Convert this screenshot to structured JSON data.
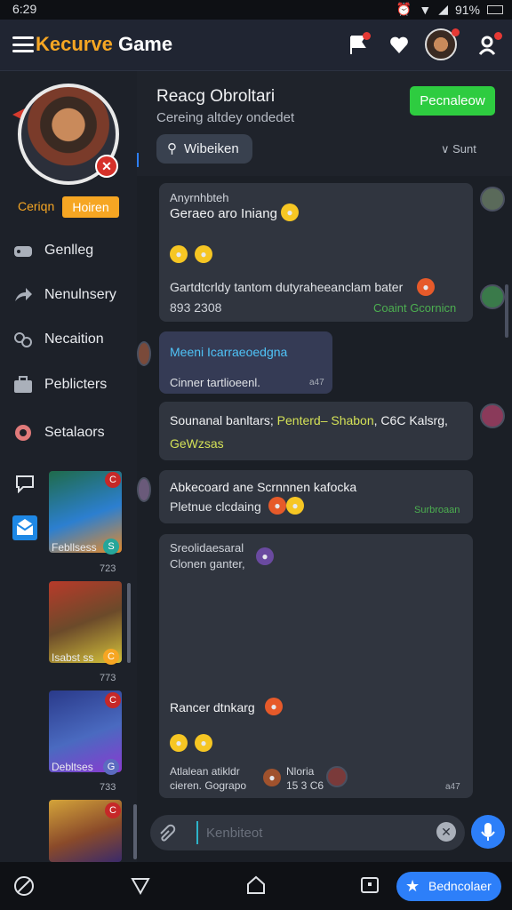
{
  "status_bar": {
    "time": "6:29",
    "battery": "91%"
  },
  "app": {
    "brand_part1": "Kecurve",
    "brand_part2": " Game"
  },
  "profile": {
    "rank_label": "Ceriqn",
    "rank_pill": "Hoiren"
  },
  "sidebar": {
    "items": [
      {
        "label": "Genlleg",
        "icon": "controller-icon"
      },
      {
        "label": "Nenulnsery",
        "icon": "share-arrow-icon"
      },
      {
        "label": "Necaition",
        "icon": "link-icon"
      },
      {
        "label": "Peblicters",
        "icon": "briefcase-icon"
      },
      {
        "label": "Setalaors",
        "icon": "gear-icon"
      }
    ],
    "thumbnails": [
      {
        "caption": "Febllsess",
        "count": "723"
      },
      {
        "caption": "Isabst ss",
        "count": "773"
      },
      {
        "caption": "Debltses",
        "count": "733"
      },
      {
        "caption": "",
        "count": ""
      }
    ]
  },
  "chat_header": {
    "title": "Reacg Obroltari",
    "subtitle": "Cereing altdey ondedet",
    "action_button": "Pecnaleow",
    "search_chip": "Wibeiken",
    "sort_label": "∨ Sunt"
  },
  "messages": [
    {
      "sender": "Anyrnhbteh",
      "line1": "Geraeo aro Iniang",
      "line2": "Gartdtcrldy tantom dutyraheeanclam bater",
      "meta_left": "893 2308",
      "meta_right": "Coaint Gcornicn"
    },
    {
      "line1": "Meeni Icarraeoedgna",
      "line2": "Cinner tartlioeenl.",
      "meta_right": "a47"
    },
    {
      "line1_a": "Sounanal banltars;",
      "line1_b": " Penterd– Shabon",
      "line1_c": ", C6C Kalsrg,",
      "line2": "GeWzsas"
    },
    {
      "line1": "Abkecoard ane Scrnnnen kafocka",
      "line2": "Pletnue clcdaing",
      "meta_right": "Surbroaan"
    },
    {
      "sender": "Sreolidaesaral",
      "sender2": "Clonen ganter,",
      "line1": "Rancer dtnkarg",
      "meta1": "Atlalean atikldr",
      "meta2": "cieren. Gograpo",
      "meta3": "Nloria",
      "meta4": "15 3 C6",
      "meta_right": "a47"
    }
  ],
  "input": {
    "placeholder": "Kenbiteot"
  },
  "fab": {
    "label": "Bedncolaer"
  }
}
